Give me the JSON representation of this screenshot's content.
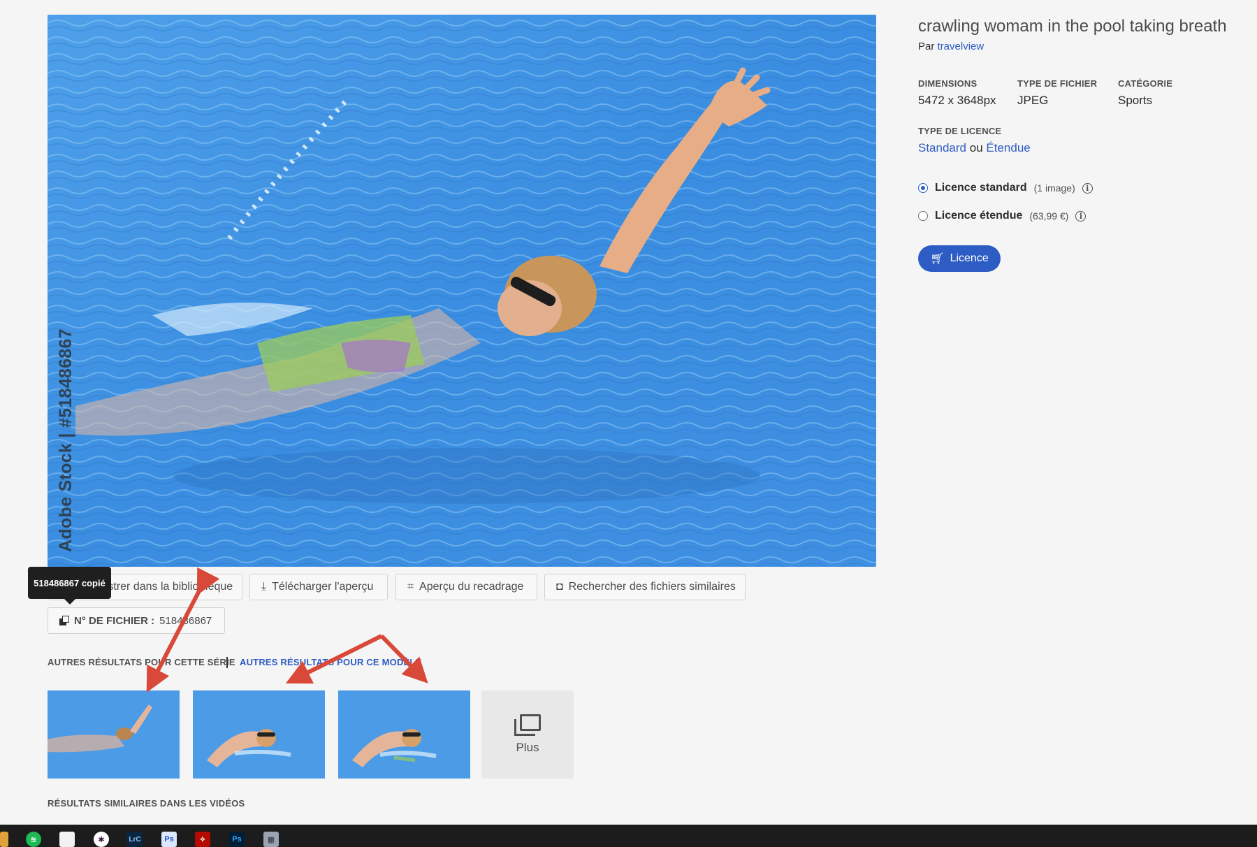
{
  "preview": {
    "watermark": "Adobe Stock | #518486867"
  },
  "actions": {
    "save_library": "Enregistrer dans la bibliothèque",
    "download_preview": "Télécharger l'aperçu",
    "crop_preview": "Aperçu du recadrage",
    "find_similar": "Rechercher des fichiers similaires"
  },
  "file_id": {
    "label": "N° DE FICHIER :",
    "value": "518486867"
  },
  "tooltip": "518486867 copié",
  "related": {
    "series_label": "AUTRES RÉSULTATS POUR CETTE SÉRIE",
    "model_label": "AUTRES RÉSULTATS POUR CE MODÈLE",
    "more_label": "Plus",
    "videos_label": "RÉSULTATS SIMILAIRES DANS LES VIDÉOS"
  },
  "details": {
    "title": "crawling womam in the pool taking breath",
    "by_prefix": "Par",
    "author": "travelview",
    "dimensions_label": "DIMENSIONS",
    "dimensions_value": "5472 x 3648px",
    "filetype_label": "TYPE DE FICHIER",
    "filetype_value": "JPEG",
    "category_label": "CATÉGORIE",
    "category_value": "Sports",
    "licensetype_label": "TYPE DE LICENCE",
    "license_standard": "Standard",
    "license_or": "ou",
    "license_extended": "Étendue"
  },
  "license_options": [
    {
      "label": "Licence standard",
      "sub": "(1 image)",
      "selected": true
    },
    {
      "label": "Licence étendue",
      "sub": "(63,99 €)",
      "selected": false
    }
  ],
  "license_button": "Licence",
  "colors": {
    "accent": "#2d5cc4",
    "annotation_arrow": "#d9493a",
    "water": "#3f8fe0"
  },
  "taskbar_icons": [
    "spotify-icon",
    "file-icon",
    "slack-icon",
    "lightroom-classic-icon",
    "photoshop-icon",
    "acrobat-icon",
    "photoshop-icon",
    "calculator-icon"
  ],
  "taskbar_labels": {
    "lightroom": "LrC",
    "photoshop": "Ps"
  }
}
